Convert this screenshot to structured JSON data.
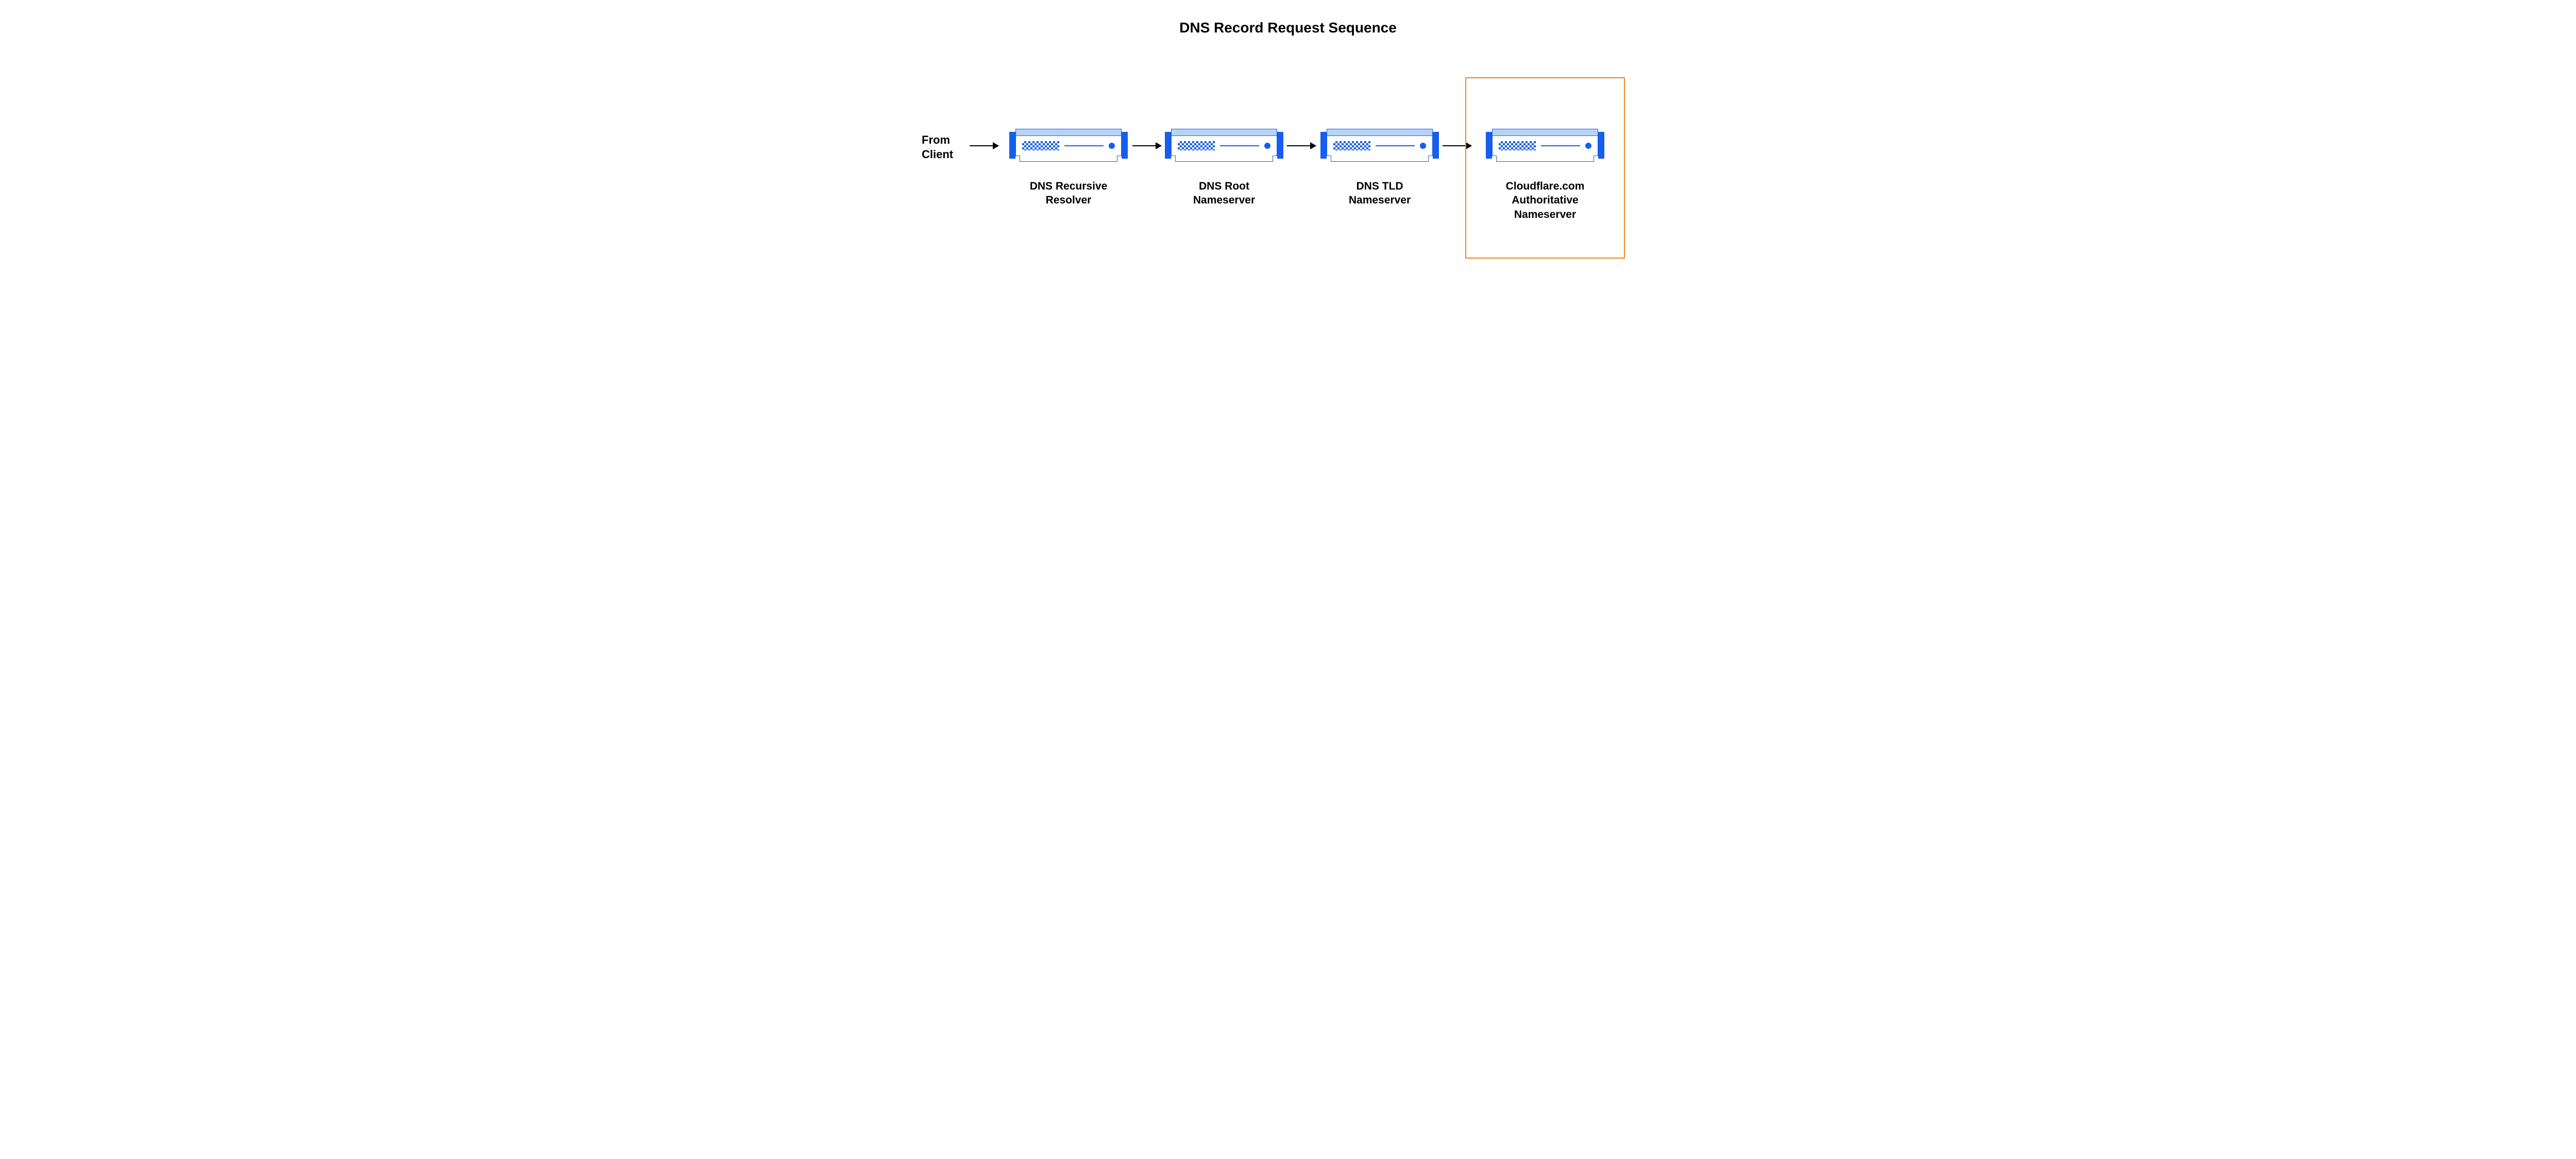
{
  "title": "DNS Record Request Sequence",
  "source_label": "From\nClient",
  "nodes": [
    {
      "label": "DNS Recursive\nResolver"
    },
    {
      "label": "DNS Root\nNameserver"
    },
    {
      "label": "DNS TLD\nNameserver"
    },
    {
      "label": "Cloudflare.com\nAuthoritative\nNameserver"
    }
  ],
  "highlight_index": 3,
  "colors": {
    "server_blue": "#155eef",
    "server_light": "#b7d3f6",
    "highlight": "#f5821f",
    "text": "#000000"
  }
}
